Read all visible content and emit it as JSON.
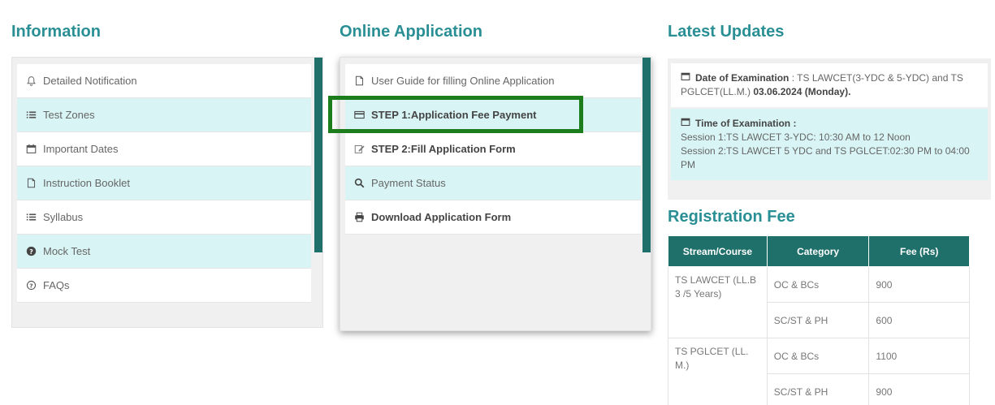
{
  "columns": {
    "information_title": "Information",
    "online_application_title": "Online Application",
    "latest_updates_title": "Latest Updates",
    "registration_fee_title": "Registration Fee"
  },
  "information": {
    "items": [
      {
        "label": "Detailed Notification",
        "icon": "bell-icon"
      },
      {
        "label": "Test Zones",
        "icon": "list-icon"
      },
      {
        "label": "Important Dates",
        "icon": "calendar-icon"
      },
      {
        "label": "Instruction Booklet",
        "icon": "document-icon"
      },
      {
        "label": "Syllabus",
        "icon": "list-icon"
      },
      {
        "label": "Mock Test",
        "icon": "question-circle-icon"
      },
      {
        "label": "FAQs",
        "icon": "question-circle-icon"
      }
    ]
  },
  "online_application": {
    "items": [
      {
        "label": "User Guide for filling Online Application",
        "icon": "document-icon"
      },
      {
        "label": "STEP 1:Application Fee Payment",
        "icon": "credit-card-icon"
      },
      {
        "label": "STEP 2:Fill Application Form",
        "icon": "edit-icon"
      },
      {
        "label": "Payment Status",
        "icon": "search-icon"
      },
      {
        "label": "Download Application Form",
        "icon": "print-icon"
      }
    ]
  },
  "latest_updates": {
    "exam_date_label": "Date of Examination",
    "exam_date_text": " : TS LAWCET(3-YDC & 5-YDC) and TS PGLCET(LL.M.) ",
    "exam_date_value": "03.06.2024 (Monday).",
    "exam_time_label": "Time of Examination :",
    "session1": "Session 1:TS LAWCET 3-YDC: 10:30 AM to 12 Noon",
    "session2": "Session 2:TS LAWCET 5 YDC and TS PGLCET:02:30 PM to 04:00 PM"
  },
  "registration_fee": {
    "headers": [
      "Stream/Course",
      "Category",
      "Fee (Rs)"
    ],
    "rows": [
      {
        "stream": "TS LAWCET (LL.B 3 /5 Years)",
        "category1": "OC & BCs",
        "fee1": "900",
        "category2": "SC/ST & PH",
        "fee2": "600"
      },
      {
        "stream": "TS PGLCET (LL. M.)",
        "category1": "OC & BCs",
        "fee1": "1100",
        "category2": "SC/ST & PH",
        "fee2": "900"
      }
    ]
  },
  "colors": {
    "accent": "#2a8f94",
    "dark_teal": "#1f6f6b",
    "row_alt": "#d8f4f5",
    "highlight_box": "#1b7d1b"
  }
}
